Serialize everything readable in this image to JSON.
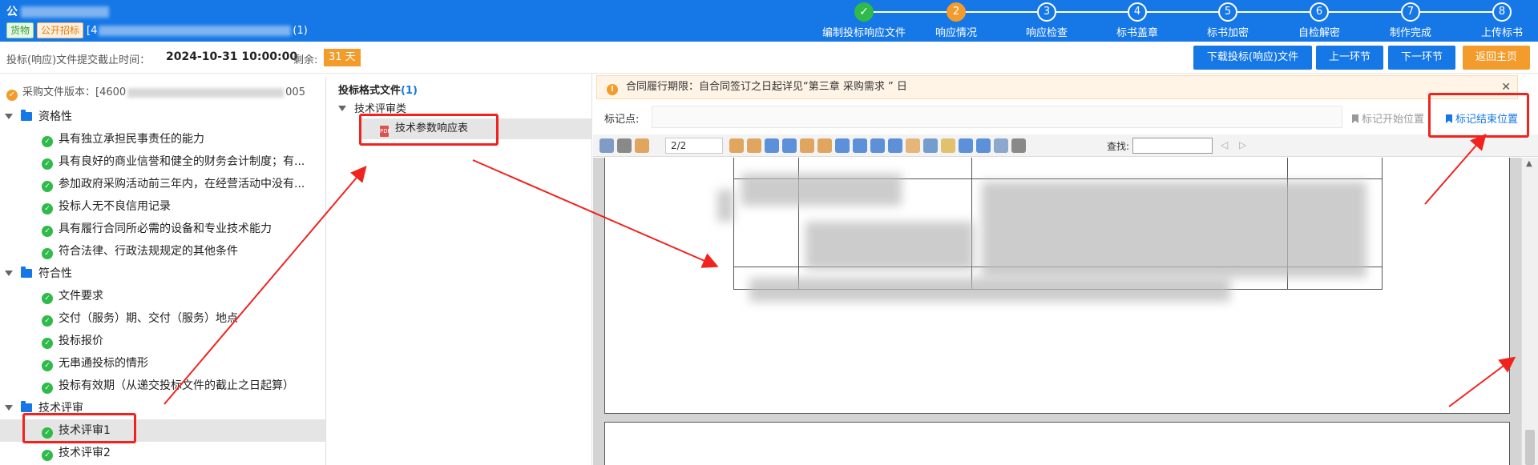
{
  "header": {
    "project_title_prefix": "公",
    "tags": [
      "货物",
      "公开招标"
    ],
    "project_code_prefix": "[4",
    "project_code_suffix": "(1)"
  },
  "steps": [
    {
      "number": "✓",
      "label": "编制投标响应文件",
      "state": "done"
    },
    {
      "number": "2",
      "label": "响应情况",
      "state": "active"
    },
    {
      "number": "3",
      "label": "响应检查",
      "state": "todo"
    },
    {
      "number": "4",
      "label": "标书盖章",
      "state": "todo"
    },
    {
      "number": "5",
      "label": "标书加密",
      "state": "todo"
    },
    {
      "number": "6",
      "label": "自检解密",
      "state": "todo"
    },
    {
      "number": "7",
      "label": "制作完成",
      "state": "todo"
    },
    {
      "number": "8",
      "label": "上传标书",
      "state": "todo"
    }
  ],
  "subbar": {
    "deadline_label": "投标(响应)文件提交截止时间：",
    "deadline_value": "2024-10-31 10:00:00",
    "remain_label": "剩余:",
    "remain_value": "31 天",
    "download_label": "下载投标(响应)文件",
    "prev_label": "上一环节",
    "next_label": "下一环节",
    "home_label": "返回主页"
  },
  "left": {
    "version_prefix": "采购文件版本：[4600",
    "version_suffix": "005",
    "groups": [
      {
        "label": "资格性",
        "items": [
          "具有独立承担民事责任的能力",
          "具有良好的商业信誉和健全的财务会计制度；有...",
          "参加政府采购活动前三年内，在经营活动中没有...",
          "投标人无不良信用记录",
          "具有履行合同所必需的设备和专业技术能力",
          "符合法律、行政法规规定的其他条件"
        ]
      },
      {
        "label": "符合性",
        "items": [
          "文件要求",
          "交付（服务）期、交付（服务）地点",
          "投标报价",
          "无串通投标的情形",
          "投标有效期（从递交投标文件的截止之日起算）"
        ]
      },
      {
        "label": "技术评审",
        "items": [
          "技术评审1",
          "技术评审2"
        ]
      }
    ],
    "selected_item": "技术评审1"
  },
  "middle": {
    "title": "投标格式文件",
    "count": "(1)",
    "group_label": "技术评审类",
    "file_label": "技术参数响应表"
  },
  "right": {
    "notice_text": "合同履行期限：自合同签订之日起详见“第三章 采购需求 ” 日",
    "mark_label": "标记点:",
    "mark_start": "标记开始位置",
    "mark_end": "标记结束位置",
    "page_indicator": "2/2",
    "find_label": "查找:"
  },
  "colors": {
    "primary": "#1677e6",
    "accent": "#f39c2b",
    "success": "#2fba4a",
    "annotation": "#f0231e"
  }
}
